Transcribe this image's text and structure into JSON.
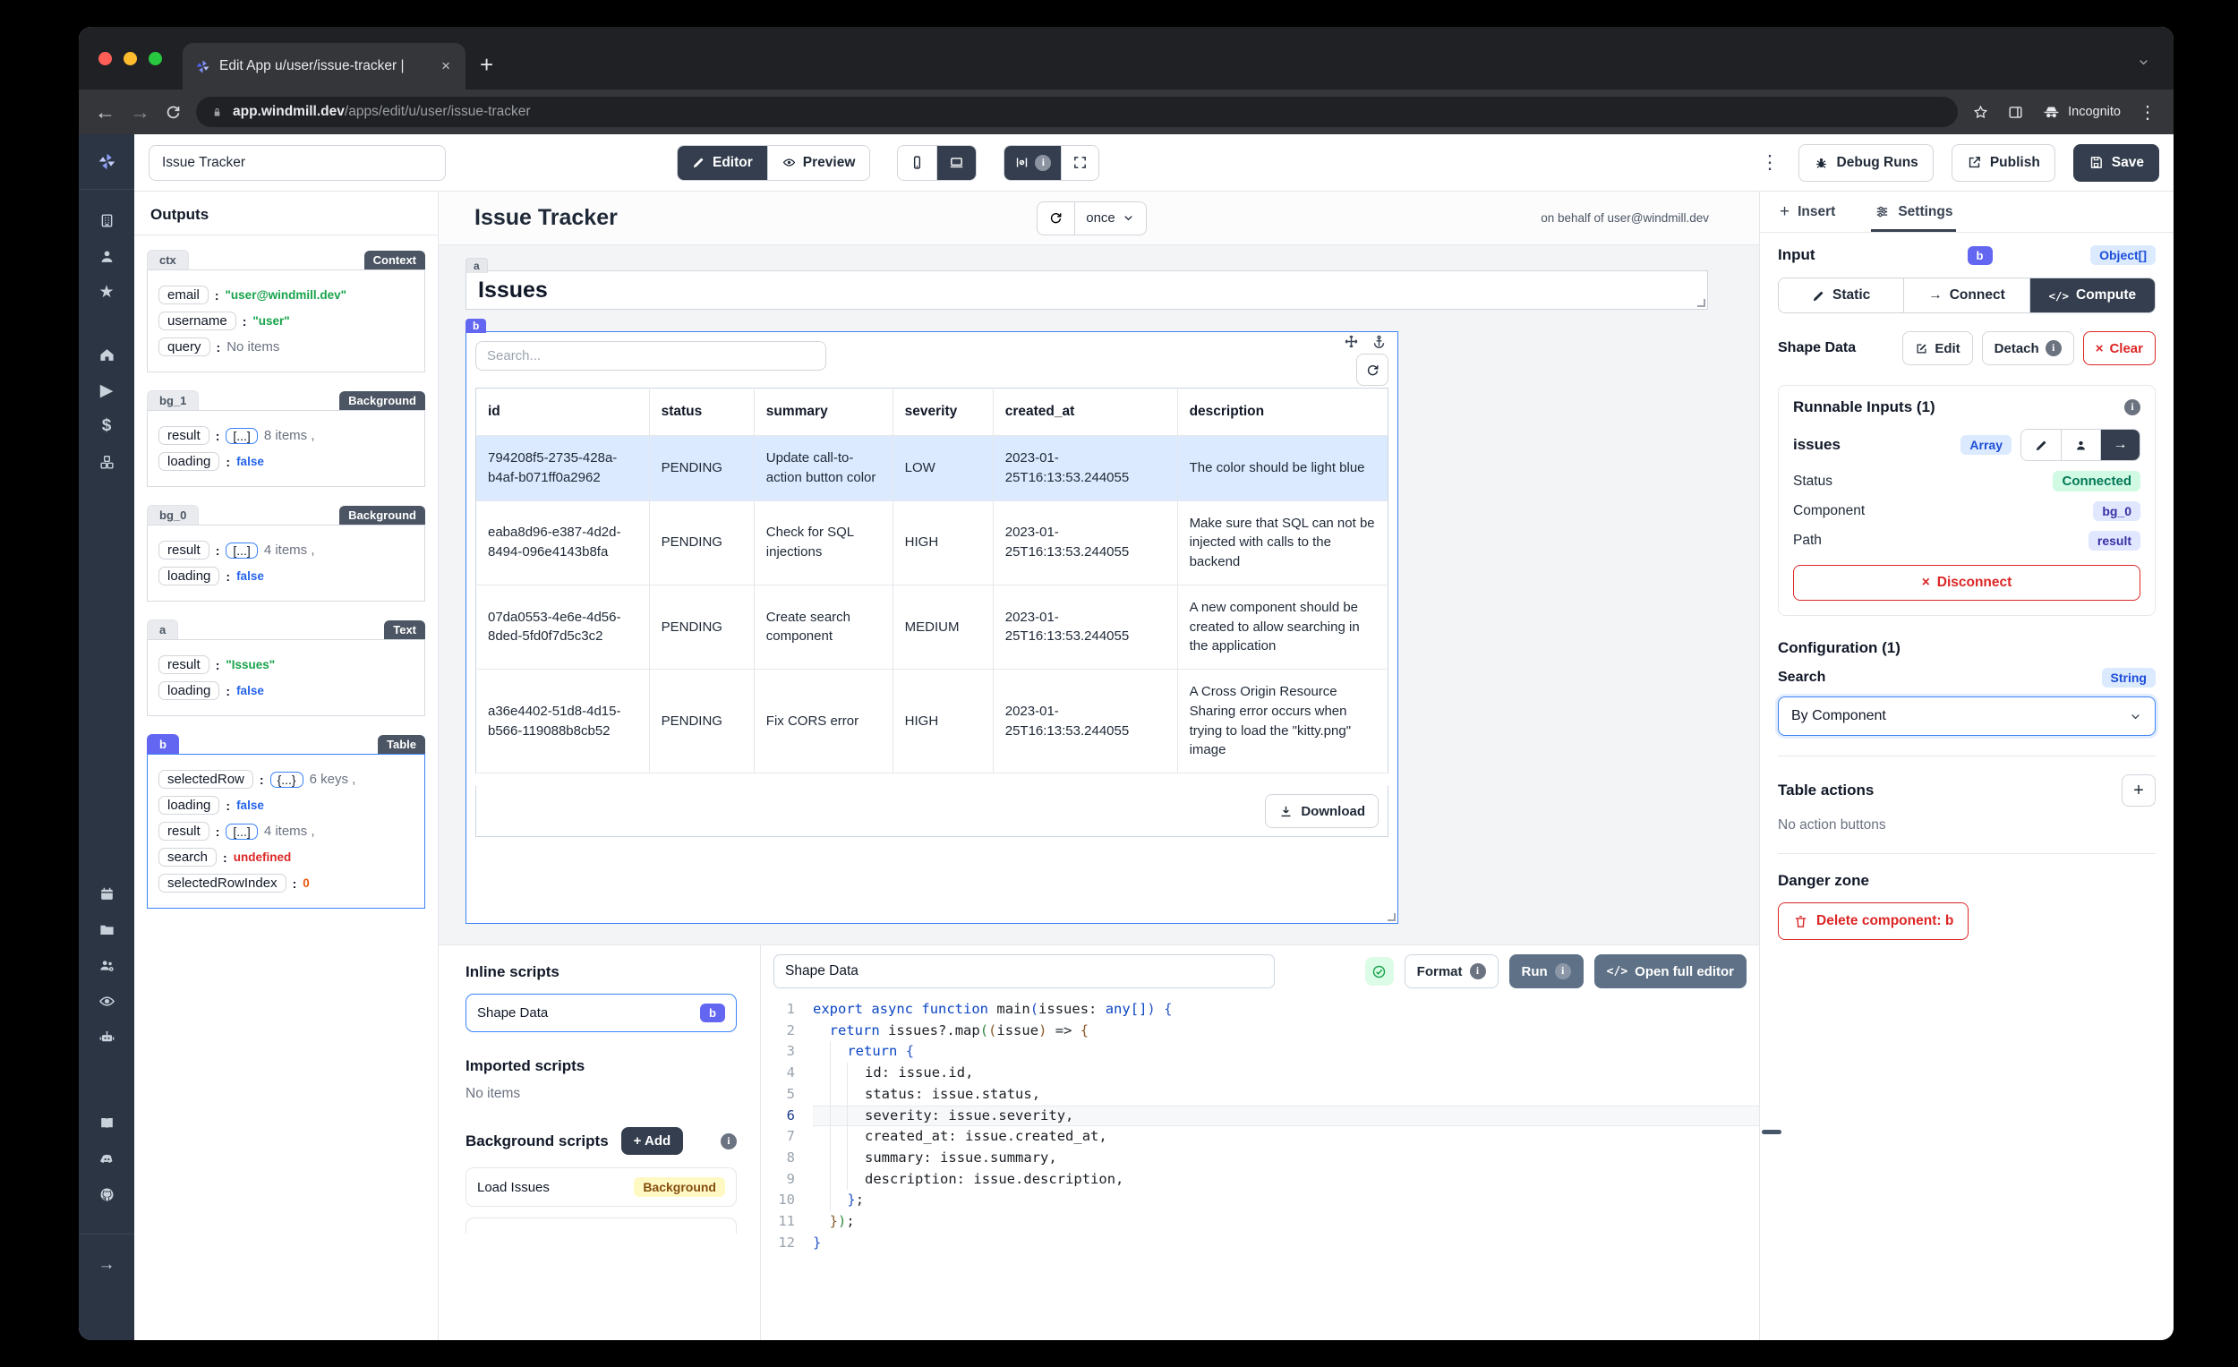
{
  "browser": {
    "tab_title": "Edit App u/user/issue-tracker |",
    "close": "×",
    "new_tab": "+",
    "url_host": "app.windmill.dev",
    "url_path": "/apps/edit/u/user/issue-tracker",
    "incognito_label": "Incognito",
    "kebab": "⋮",
    "back": "←",
    "forward": "→"
  },
  "toolbar": {
    "app_name": "Issue Tracker",
    "editor": "Editor",
    "preview": "Preview",
    "debug_runs": "Debug Runs",
    "publish": "Publish",
    "save": "Save",
    "kebab": "⋮"
  },
  "outputs": {
    "title": "Outputs",
    "sections": [
      {
        "id": "ctx",
        "kind": "Context",
        "selected": false,
        "items": [
          {
            "key": "email",
            "type": "string",
            "value": "\"user@windmill.dev\""
          },
          {
            "key": "username",
            "type": "string",
            "value": "\"user\""
          },
          {
            "key": "query",
            "type": "plain",
            "value": "No items"
          }
        ]
      },
      {
        "id": "bg_1",
        "kind": "Background",
        "selected": false,
        "items": [
          {
            "key": "result",
            "type": "array",
            "value": "8 items ,"
          },
          {
            "key": "loading",
            "type": "bool",
            "value": "false"
          }
        ]
      },
      {
        "id": "bg_0",
        "kind": "Background",
        "selected": false,
        "items": [
          {
            "key": "result",
            "type": "array",
            "value": "4 items ,"
          },
          {
            "key": "loading",
            "type": "bool",
            "value": "false"
          }
        ]
      },
      {
        "id": "a",
        "kind": "Text",
        "selected": false,
        "items": [
          {
            "key": "result",
            "type": "string",
            "value": "\"Issues\""
          },
          {
            "key": "loading",
            "type": "bool",
            "value": "false"
          }
        ]
      },
      {
        "id": "b",
        "kind": "Table",
        "selected": true,
        "items": [
          {
            "key": "selectedRow",
            "type": "object",
            "value": "6 keys ,"
          },
          {
            "key": "loading",
            "type": "bool",
            "value": "false"
          },
          {
            "key": "result",
            "type": "array",
            "value": "4 items ,"
          },
          {
            "key": "search",
            "type": "undef",
            "value": "undefined"
          },
          {
            "key": "selectedRowIndex",
            "type": "num",
            "value": "0"
          }
        ]
      }
    ]
  },
  "canvas": {
    "app_title": "Issue Tracker",
    "schedule": "once",
    "behalf": "on behalf of user@windmill.dev",
    "text_component": "Issues",
    "table": {
      "search_placeholder": "Search...",
      "columns": [
        "id",
        "status",
        "summary",
        "severity",
        "created_at",
        "description"
      ],
      "rows": [
        [
          "794208f5-2735-428a-b4af-b071ff0a2962",
          "PENDING",
          "Update call-to-action button color",
          "LOW",
          "2023-01-25T16:13:53.244055",
          "The color should be light blue"
        ],
        [
          "eaba8d96-e387-4d2d-8494-096e4143b8fa",
          "PENDING",
          "Check for SQL injections",
          "HIGH",
          "2023-01-25T16:13:53.244055",
          "Make sure that SQL can not be injected with calls to the backend"
        ],
        [
          "07da0553-4e6e-4d56-8ded-5fd0f7d5c3c2",
          "PENDING",
          "Create search component",
          "MEDIUM",
          "2023-01-25T16:13:53.244055",
          "A new component should be created to allow searching in the application"
        ],
        [
          "a36e4402-51d8-4d15-b566-119088b8cb52",
          "PENDING",
          "Fix CORS error",
          "HIGH",
          "2023-01-25T16:13:53.244055",
          "A Cross Origin Resource Sharing error occurs when trying to load the \"kitty.png\" image"
        ]
      ],
      "download_label": "Download"
    }
  },
  "scripts": {
    "inline_title": "Inline scripts",
    "inline_item": "Shape Data",
    "inline_badge": "b",
    "imported_title": "Imported scripts",
    "imported_empty": "No items",
    "background_title": "Background scripts",
    "add_label": "+ Add",
    "background_item": "Load Issues",
    "background_badge": "Background"
  },
  "editor": {
    "name": "Shape Data",
    "format_label": "Format",
    "run_label": "Run",
    "open_full_label": "Open full editor",
    "current_line": 6,
    "lines": [
      "export async function main(issues: any[]) {",
      "  return issues?.map((issue) => {",
      "    return {",
      "      id: issue.id,",
      "      status: issue.status,",
      "      severity: issue.severity,",
      "      created_at: issue.created_at,",
      "      summary: issue.summary,",
      "      description: issue.description,",
      "    };",
      "  });",
      "}"
    ]
  },
  "settings": {
    "insert_tab": "Insert",
    "settings_tab": "Settings",
    "input_title": "Input",
    "component_badge": "b",
    "input_type": "Object[]",
    "static_label": "Static",
    "connect_label": "Connect",
    "compute_label": "Compute",
    "shape_data_label": "Shape Data",
    "edit_label": "Edit",
    "detach_label": "Detach",
    "clear_label": "Clear",
    "runnable_title": "Runnable Inputs (1)",
    "field_name": "issues",
    "field_type": "Array",
    "status_label": "Status",
    "status_value": "Connected",
    "component_label": "Component",
    "component_value": "bg_0",
    "path_label": "Path",
    "path_value": "result",
    "disconnect_label": "Disconnect",
    "config_title": "Configuration (1)",
    "search_label": "Search",
    "search_type": "String",
    "search_value": "By Component",
    "table_actions_title": "Table actions",
    "table_actions_empty": "No action buttons",
    "danger_title": "Danger zone",
    "delete_label": "Delete component: b"
  },
  "colors": {
    "accent_blue": "#3b82f6",
    "indigo_badge": "#6366f1",
    "dark_button": "#343e4e",
    "connected_green_bg": "#d1fae5",
    "background_badge_bg": "#fef9c3",
    "danger_red": "#dc2626",
    "selected_row_bg": "#dbeafe"
  },
  "sidebar_icons": [
    "windmill-logo",
    "building",
    "user",
    "star",
    "home",
    "play",
    "dollar",
    "cubes",
    "calendar",
    "folder",
    "user-group",
    "eye",
    "robot",
    "book",
    "discord",
    "github",
    "arrow-right"
  ],
  "icons_map": {
    "refresh": "↻",
    "chevron_down": "⌄",
    "kebab": "⋮",
    "close": "×",
    "plus": "+",
    "arrow_right": "→"
  }
}
